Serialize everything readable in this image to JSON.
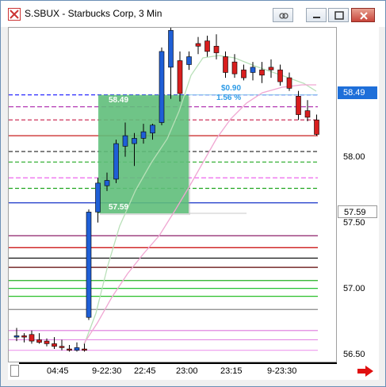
{
  "window": {
    "title": "S.SBUX - Starbucks Corp, 3 Min"
  },
  "y_axis": {
    "labels": [
      "58.00",
      "57.50",
      "57.00",
      "56.50"
    ],
    "last_price": "58.49",
    "reference_price": "57.59"
  },
  "x_axis": {
    "labels": [
      "04:45",
      "9-22:30",
      "22:45",
      "23:00",
      "23:15",
      "9-23:30"
    ]
  },
  "measure": {
    "top_price": "58.49",
    "bottom_price": "57.59",
    "change": "$0.90",
    "change_percent": "1.56 %"
  },
  "colors": {
    "up_candle": "#1f5fd6",
    "down_candle": "#d81e1e",
    "last_price_tag": "#1e6fd9",
    "measure_fill": "#5cbf78",
    "measure_text": "#2e9be6"
  },
  "chart_data": {
    "type": "candlestick",
    "interval": "3 Min",
    "ylim": [
      56.4,
      58.95
    ],
    "candles": [
      {
        "o": 56.65,
        "h": 56.72,
        "l": 56.62,
        "c": 56.66
      },
      {
        "o": 56.66,
        "h": 56.68,
        "l": 56.61,
        "c": 56.65
      },
      {
        "o": 56.67,
        "h": 56.7,
        "l": 56.6,
        "c": 56.62
      },
      {
        "o": 56.63,
        "h": 56.68,
        "l": 56.6,
        "c": 56.61
      },
      {
        "o": 56.62,
        "h": 56.64,
        "l": 56.58,
        "c": 56.6
      },
      {
        "o": 56.6,
        "h": 56.65,
        "l": 56.56,
        "c": 56.58
      },
      {
        "o": 56.58,
        "h": 56.63,
        "l": 56.55,
        "c": 56.57
      },
      {
        "o": 56.56,
        "h": 56.59,
        "l": 56.54,
        "c": 56.55
      },
      {
        "o": 56.55,
        "h": 56.61,
        "l": 56.54,
        "c": 56.57
      },
      {
        "o": 56.56,
        "h": 56.6,
        "l": 56.54,
        "c": 56.55
      },
      {
        "o": 56.8,
        "h": 57.62,
        "l": 56.78,
        "c": 57.6
      },
      {
        "o": 57.6,
        "h": 57.86,
        "l": 57.52,
        "c": 57.82
      },
      {
        "o": 57.8,
        "h": 57.9,
        "l": 57.76,
        "c": 57.84
      },
      {
        "o": 57.85,
        "h": 58.15,
        "l": 57.82,
        "c": 58.12
      },
      {
        "o": 58.1,
        "h": 58.28,
        "l": 58.02,
        "c": 58.18
      },
      {
        "o": 58.12,
        "h": 58.2,
        "l": 57.95,
        "c": 58.16
      },
      {
        "o": 58.16,
        "h": 58.27,
        "l": 58.12,
        "c": 58.21
      },
      {
        "o": 58.2,
        "h": 58.27,
        "l": 58.15,
        "c": 58.26
      },
      {
        "o": 58.28,
        "h": 58.85,
        "l": 58.26,
        "c": 58.82
      },
      {
        "o": 58.7,
        "h": 59.1,
        "l": 58.46,
        "c": 58.98
      },
      {
        "o": 58.75,
        "h": 58.82,
        "l": 58.44,
        "c": 58.5
      },
      {
        "o": 58.72,
        "h": 58.82,
        "l": 58.68,
        "c": 58.78
      },
      {
        "o": 58.88,
        "h": 58.93,
        "l": 58.8,
        "c": 58.86
      },
      {
        "o": 58.9,
        "h": 58.94,
        "l": 58.78,
        "c": 58.82
      },
      {
        "o": 58.86,
        "h": 58.95,
        "l": 58.76,
        "c": 58.81
      },
      {
        "o": 58.78,
        "h": 58.82,
        "l": 58.62,
        "c": 58.66
      },
      {
        "o": 58.74,
        "h": 58.8,
        "l": 58.62,
        "c": 58.65
      },
      {
        "o": 58.68,
        "h": 58.72,
        "l": 58.6,
        "c": 58.62
      },
      {
        "o": 58.66,
        "h": 58.74,
        "l": 58.6,
        "c": 58.7
      },
      {
        "o": 58.68,
        "h": 58.74,
        "l": 58.58,
        "c": 58.64
      },
      {
        "o": 58.7,
        "h": 58.76,
        "l": 58.62,
        "c": 58.68
      },
      {
        "o": 58.68,
        "h": 58.72,
        "l": 58.56,
        "c": 58.59
      },
      {
        "o": 58.62,
        "h": 58.66,
        "l": 58.52,
        "c": 58.54
      },
      {
        "o": 58.48,
        "h": 58.52,
        "l": 58.3,
        "c": 58.34
      },
      {
        "o": 58.37,
        "h": 58.45,
        "l": 58.29,
        "c": 58.32
      },
      {
        "o": 58.3,
        "h": 58.34,
        "l": 58.18,
        "c": 58.19
      }
    ],
    "levels": [
      {
        "price": 58.49,
        "color": "#2a2aff",
        "dash": "5,3"
      },
      {
        "price": 58.4,
        "color": "#b43ab4",
        "dash": "6,3"
      },
      {
        "price": 58.3,
        "color": "#c81e4a",
        "dash": "5,3"
      },
      {
        "price": 58.18,
        "color": "#c81e1e",
        "dash": ""
      },
      {
        "price": 58.06,
        "color": "#222222",
        "dash": "5,3"
      },
      {
        "price": 57.98,
        "color": "#22aa22",
        "dash": "5,3"
      },
      {
        "price": 57.86,
        "color": "#ee66ee",
        "dash": "6,3"
      },
      {
        "price": 57.78,
        "color": "#1fa51f",
        "dash": "5,3"
      },
      {
        "price": 57.67,
        "color": "#1532c8",
        "dash": ""
      },
      {
        "price": 57.42,
        "color": "#8b1f6a",
        "dash": ""
      },
      {
        "price": 57.33,
        "color": "#c80000",
        "dash": ""
      },
      {
        "price": 57.25,
        "color": "#111111",
        "dash": ""
      },
      {
        "price": 57.18,
        "color": "#5c0000",
        "dash": ""
      },
      {
        "price": 57.08,
        "color": "#22b022",
        "dash": ""
      },
      {
        "price": 57.02,
        "color": "#06bc18",
        "dash": ""
      },
      {
        "price": 56.96,
        "color": "#28c028",
        "dash": ""
      },
      {
        "price": 56.86,
        "color": "#888888",
        "dash": ""
      },
      {
        "price": 56.7,
        "color": "#dd77dd",
        "dash": ""
      },
      {
        "price": 56.63,
        "color": "#e58ae5",
        "dash": ""
      },
      {
        "price": 56.55,
        "color": "#ee99ee",
        "dash": ""
      }
    ]
  }
}
